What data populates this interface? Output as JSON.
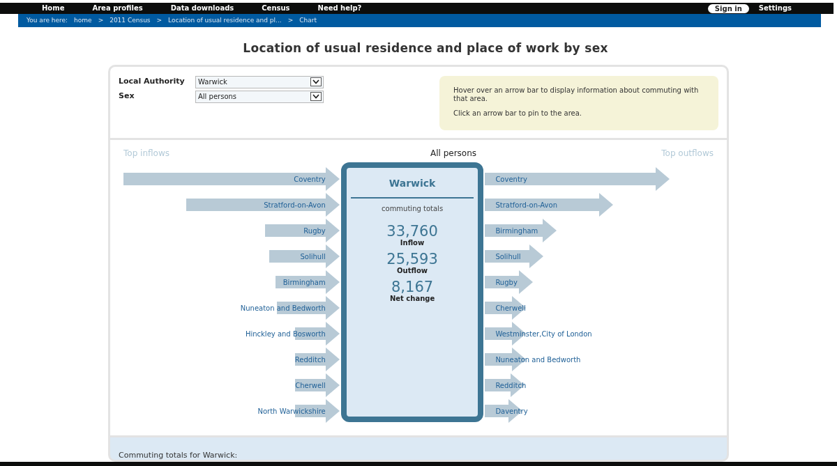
{
  "top_nav": {
    "items": [
      "Home",
      "Area profiles",
      "Data downloads",
      "Census",
      "Need help?"
    ],
    "sign_in": "Sign in",
    "settings": "Settings"
  },
  "breadcrumb": {
    "prefix": "You are here:",
    "items": [
      "home",
      "2011 Census",
      "Location of usual residence and pl...",
      "Chart"
    ],
    "separator": ">"
  },
  "title": "Location of usual residence and place of work by sex",
  "filters": [
    {
      "label": "Local Authority",
      "value": "Warwick"
    },
    {
      "label": "Sex",
      "value": "All persons"
    }
  ],
  "info_box": {
    "lines": [
      "Hover over an arrow bar to display information about commuting with that area.",
      "Click an arrow bar to pin to the area."
    ]
  },
  "chart": {
    "inflows_heading": "Top inflows",
    "subset": "All persons",
    "outflows_heading": "Top outflows",
    "inflows": [
      {
        "name": "Coventry"
      },
      {
        "name": "Stratford-on-Avon"
      },
      {
        "name": "Rugby"
      },
      {
        "name": "Solihull"
      },
      {
        "name": "Birmingham"
      },
      {
        "name": "Nuneaton and Bedworth"
      },
      {
        "name": "Hinckley and Bosworth"
      },
      {
        "name": "Redditch"
      },
      {
        "name": "Cherwell"
      },
      {
        "name": "North Warwickshire"
      }
    ],
    "outflows": [
      {
        "name": "Coventry"
      },
      {
        "name": "Stratford-on-Avon"
      },
      {
        "name": "Birmingham"
      },
      {
        "name": "Solihull"
      },
      {
        "name": "Rugby"
      },
      {
        "name": "Cherwell"
      },
      {
        "name": "Westminster,City of London"
      },
      {
        "name": "Nuneaton and Bedworth"
      },
      {
        "name": "Redditch"
      },
      {
        "name": "Daventry"
      }
    ],
    "centre": {
      "area": "Warwick",
      "subtitle": "commuting totals",
      "totals": [
        {
          "value": "33,760",
          "label": "Inflow"
        },
        {
          "value": "25,593",
          "label": "Outflow"
        },
        {
          "value": "8,167",
          "label": "Net change"
        }
      ]
    }
  },
  "summary": {
    "heading": "Commuting totals for Warwick:"
  }
}
